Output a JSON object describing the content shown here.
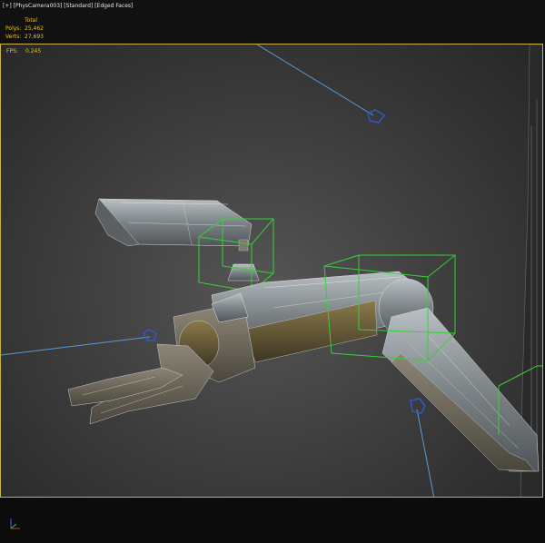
{
  "viewport": {
    "label": "[+] [PhysCamera003] [Standard] [Edged Faces]",
    "stats": {
      "header": "Total",
      "polys_label": "Polys:",
      "polys_value": "25,462",
      "verts_label": "Verts:",
      "verts_value": "27,693",
      "fps_label": "FPS:",
      "fps_value": "0.245"
    }
  },
  "colors": {
    "stats_text": "#f0c020",
    "viewport_border": "#c8b43c",
    "selection_box": "#35d235",
    "light_line": "#5a9ad8",
    "camera_icon": "#3357c8"
  },
  "icons": [
    "camera-target-icon",
    "light-icon",
    "axis-gizmo-icon"
  ]
}
